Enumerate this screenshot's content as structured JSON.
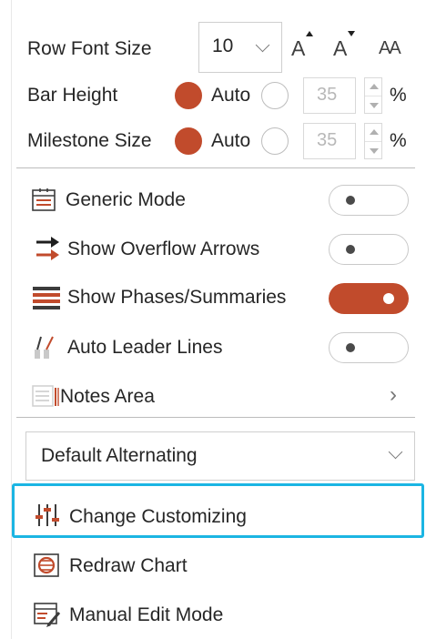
{
  "text_format": {
    "row_font_size_label": "Row Font Size",
    "font_size_value": "10",
    "increase_font_glyph": "A",
    "decrease_font_glyph": "A",
    "font_case_glyph": "AA"
  },
  "bar_height": {
    "label": "Bar Height",
    "auto_label": "Auto",
    "auto_selected": true,
    "value": "35",
    "unit": "%"
  },
  "milestone_size": {
    "label": "Milestone Size",
    "auto_label": "Auto",
    "auto_selected": true,
    "value": "35",
    "unit": "%"
  },
  "toggles": [
    {
      "label": "Generic Mode",
      "icon": "generic-mode-icon",
      "on": false
    },
    {
      "label": "Show Overflow Arrows",
      "icon": "overflow-arrows-icon",
      "on": false
    },
    {
      "label": "Show Phases/Summaries",
      "icon": "phases-summaries-icon",
      "on": true
    },
    {
      "label": "Auto Leader Lines",
      "icon": "leader-lines-icon",
      "on": false
    }
  ],
  "notes_area": {
    "label": "Notes Area",
    "chevron": "›"
  },
  "style_dropdown": {
    "selected": "Default Alternating"
  },
  "actions": {
    "change_customizing": "Change Customizing",
    "redraw_chart": "Redraw Chart",
    "manual_edit_mode": "Manual Edit Mode"
  },
  "colors": {
    "accent": "#c14b2c",
    "highlight": "#1bb5e3",
    "text": "#262626"
  }
}
